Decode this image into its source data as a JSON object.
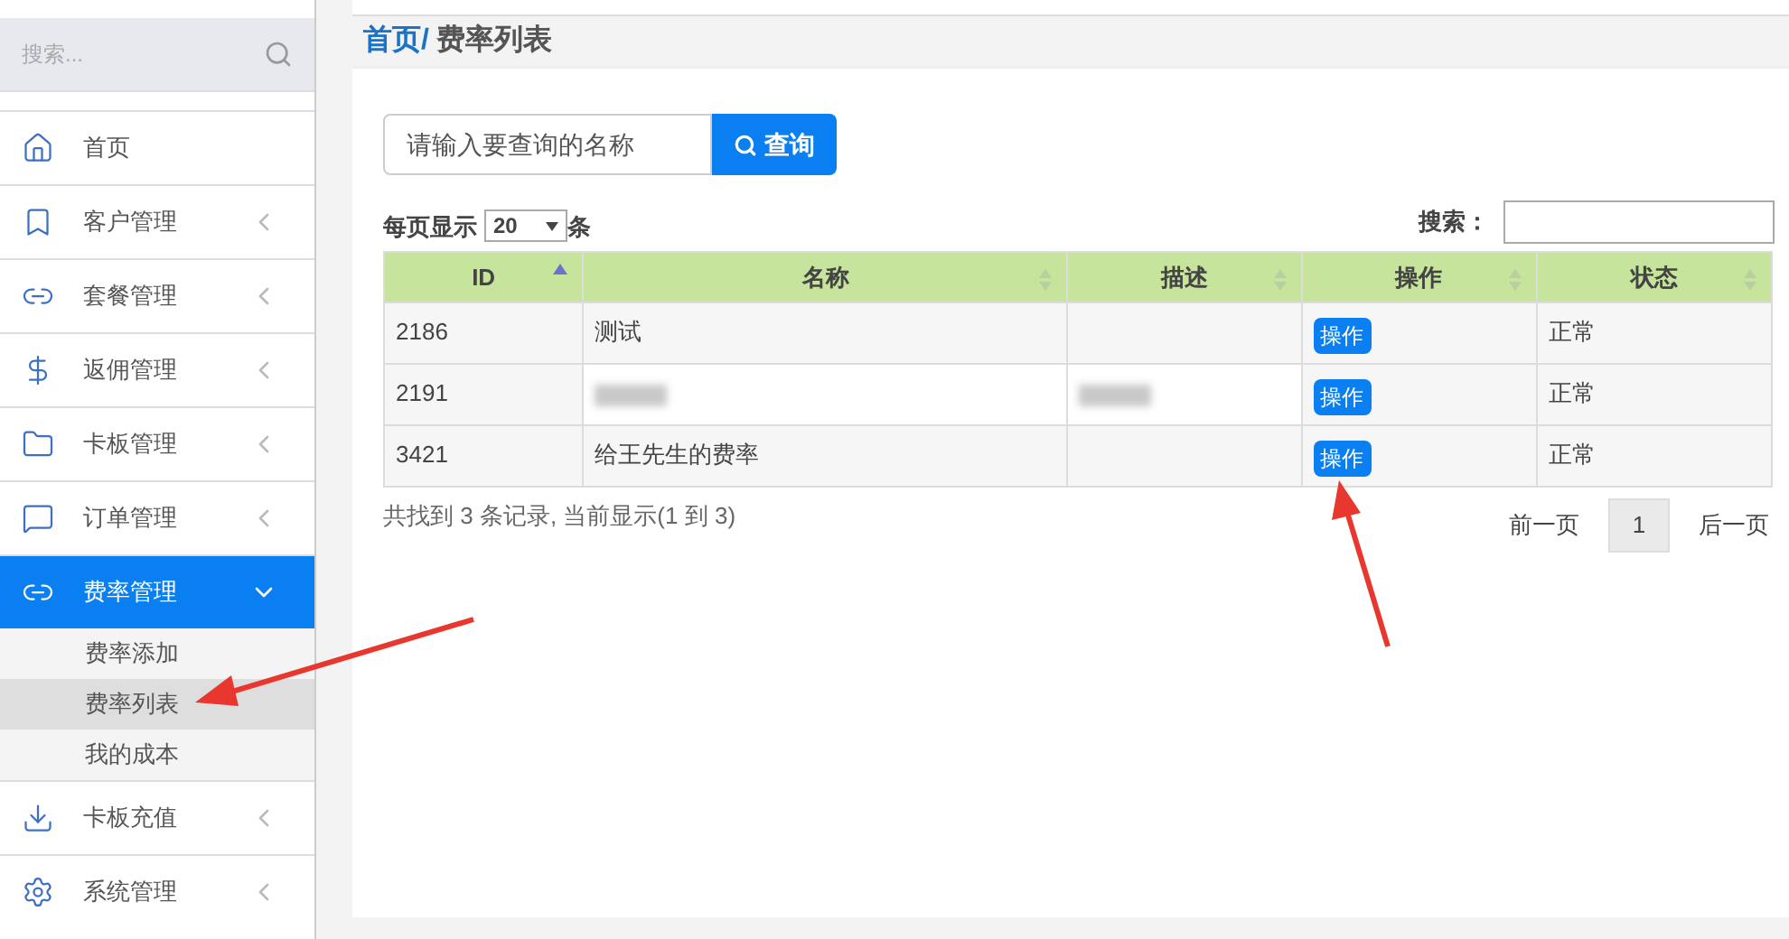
{
  "sidebar": {
    "search": {
      "placeholder": "搜索..."
    },
    "items": [
      {
        "label": "首页",
        "kind": "link",
        "selected": false
      },
      {
        "label": "客户管理",
        "kind": "group",
        "selected": false
      },
      {
        "label": "套餐管理",
        "kind": "group",
        "selected": false
      },
      {
        "label": "返佣管理",
        "kind": "group",
        "selected": false
      },
      {
        "label": "卡板管理",
        "kind": "group",
        "selected": false
      },
      {
        "label": "订单管理",
        "kind": "group",
        "selected": false
      },
      {
        "label": "费率管理",
        "kind": "group",
        "selected": true,
        "children": [
          {
            "label": "费率添加",
            "selected": false
          },
          {
            "label": "费率列表",
            "selected": true
          },
          {
            "label": "我的成本",
            "selected": false
          }
        ]
      },
      {
        "label": "卡板充值",
        "kind": "group",
        "selected": false
      },
      {
        "label": "系统管理",
        "kind": "group",
        "selected": false
      }
    ]
  },
  "breadcrumb": {
    "home": "首页",
    "separator": "/",
    "current": "费率列表"
  },
  "query": {
    "placeholder": "请输入要查询的名称",
    "button": "查询"
  },
  "page_size": {
    "before": "每页显示",
    "value": "20",
    "after": "条"
  },
  "filter": {
    "label": "搜索："
  },
  "table": {
    "columns": [
      {
        "label": "ID",
        "kind": "sorted"
      },
      {
        "label": "名称",
        "kind": "sortable"
      },
      {
        "label": "描述",
        "kind": "sortable"
      },
      {
        "label": "操作",
        "kind": "sortable"
      },
      {
        "label": "状态",
        "kind": "sortable"
      }
    ],
    "rows": [
      {
        "id": "2186",
        "name": {
          "kind": "text",
          "text": "测试"
        },
        "desc": {
          "kind": "empty"
        },
        "action": "操作",
        "status": "正常"
      },
      {
        "id": "2191",
        "name": {
          "kind": "blurred"
        },
        "desc": {
          "kind": "blurred"
        },
        "action": "操作",
        "status": "正常"
      },
      {
        "id": "3421",
        "name": {
          "kind": "text",
          "text": "给王先生的费率"
        },
        "desc": {
          "kind": "empty"
        },
        "action": "操作",
        "status": "正常"
      }
    ]
  },
  "summary": "共找到 3 条记录, 当前显示(1 到 3)",
  "pagination": {
    "prev": "前一页",
    "pages": [
      {
        "label": "1",
        "selected": true
      }
    ],
    "next": "后一页"
  }
}
